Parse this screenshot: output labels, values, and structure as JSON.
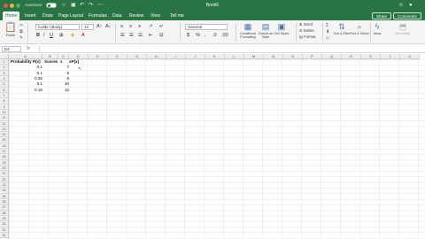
{
  "titlebar": {
    "autosave_label": "AutoSave",
    "autosave_state": "OFF",
    "title": "Book6",
    "quick_access_icons": [
      "home-icon",
      "save-icon",
      "undo-icon",
      "redo-icon",
      "more-icon"
    ],
    "right_icons": [
      "smiley-icon",
      "user-icon"
    ]
  },
  "tabs": [
    "Home",
    "Insert",
    "Draw",
    "Page Layout",
    "Formulas",
    "Data",
    "Review",
    "View",
    "Tell me"
  ],
  "active_tab": "Home",
  "share": {
    "share_label": "Share",
    "comments_label": "Comments"
  },
  "ribbon": {
    "paste_label": "Paste",
    "font_name": "Calibri (Body)",
    "font_size": "12",
    "number_format": "General",
    "conditional_formatting": "Conditional Formatting",
    "format_as_table": "Format as Table",
    "cell_styles": "Cell Styles",
    "insert": "Insert",
    "delete": "Delete",
    "format": "Format",
    "sort_filter": "Sort & Filter",
    "find_select": "Find & Select",
    "ideas": "Ideas",
    "sensitivity": "Sensitivity"
  },
  "formula_bar": {
    "name_box": "E3",
    "fx": "fx",
    "content": ""
  },
  "columns": [
    "A",
    "B",
    "C",
    "D",
    "E",
    "F",
    "G",
    "H",
    "I",
    "J",
    "K",
    "L",
    "M",
    "N",
    "O",
    "P",
    "Q",
    "R",
    "S",
    "T",
    "U"
  ],
  "rows": [
    "1",
    "2",
    "3",
    "4",
    "5",
    "6",
    "7",
    "8",
    "9",
    "10",
    "11",
    "12",
    "13",
    "14",
    "15",
    "16",
    "17",
    "18",
    "19",
    "20",
    "21",
    "22",
    "23",
    "24",
    "25",
    "26",
    "27",
    "28",
    "29",
    "30",
    "31",
    "32",
    "33"
  ],
  "sheet": {
    "headers": {
      "a": "Probability P(x)",
      "b": "Scores",
      "c": "x",
      "d": "xP(x)"
    },
    "rows": [
      {
        "a": "0.1",
        "b": "7"
      },
      {
        "a": "0.1",
        "b": "8"
      },
      {
        "a": "0.35",
        "b": "9"
      },
      {
        "a": "0.1",
        "b": "10"
      },
      {
        "a": "0.15",
        "b": "12"
      }
    ]
  }
}
